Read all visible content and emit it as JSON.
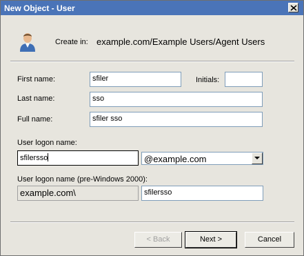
{
  "window": {
    "title": "New Object - User"
  },
  "header": {
    "create_in_label": "Create in:",
    "create_in_path": "example.com/Example Users/Agent Users"
  },
  "form": {
    "first_name_label": "First name:",
    "first_name_value": "sfiler",
    "initials_label": "Initials:",
    "initials_value": "",
    "last_name_label": "Last name:",
    "last_name_value": "sso",
    "full_name_label": "Full name:",
    "full_name_value": "sfiler sso",
    "logon_name_label": "User logon name:",
    "logon_name_value": "sfilersso",
    "domain_selected": "@example.com",
    "pre2000_label": "User logon name (pre-Windows 2000):",
    "pre2000_domain": "example.com\\",
    "pre2000_value": "sfilersso"
  },
  "buttons": {
    "back": "< Back",
    "next": "Next >",
    "cancel": "Cancel"
  },
  "icons": {
    "close": "close-icon",
    "user": "user-icon",
    "dropdown": "chevron-down-icon"
  }
}
